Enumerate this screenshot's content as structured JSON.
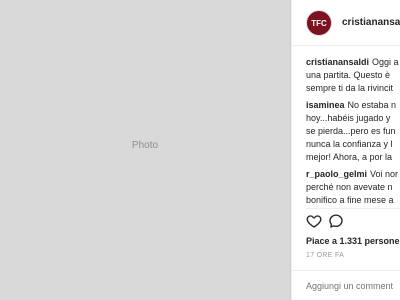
{
  "post": {
    "username": "cristianansaldi",
    "avatar_initials": "TFC",
    "likes_text": "Piace a 1.331 persone",
    "time_text": "17 ORE FA",
    "add_comment_placeholder": "Aggiungi un comment",
    "colors": {
      "avatar": "#7a1220",
      "text": "#262626",
      "muted": "#999999",
      "divider": "#efefef"
    },
    "icons": [
      "heart-icon",
      "comment-icon"
    ]
  },
  "comments": [
    {
      "user": "cristianansaldi",
      "lines": [
        "Oggi a",
        "una partita. Questo è",
        "sempre ti da la rivincit"
      ]
    },
    {
      "user": "isaminea",
      "lines": [
        "No estaba n",
        "hoy...habéis jugado y",
        "se pierda...pero es fun",
        "nunca la confianza y l",
        "mejor! Ahora, a por la"
      ]
    },
    {
      "user": "r_paolo_gelmi",
      "lines": [
        "Voi nor",
        "perché non avevate n",
        "bonifico a fine mese a"
      ]
    }
  ]
}
